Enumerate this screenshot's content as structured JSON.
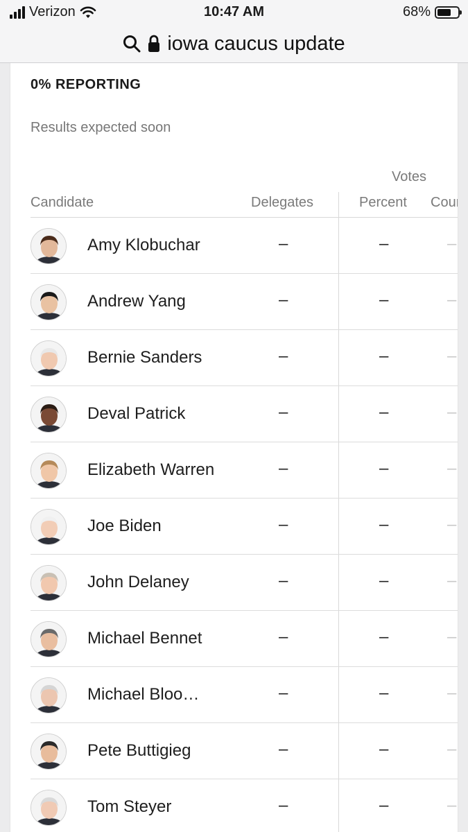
{
  "status_bar": {
    "carrier": "Verizon",
    "time": "10:47 AM",
    "battery": "68%",
    "battery_level": 0.68
  },
  "address_bar": {
    "query": "iowa caucus update"
  },
  "results": {
    "reporting": "0% REPORTING",
    "subtitle": "Results expected soon",
    "votes_header": "Votes",
    "columns": {
      "candidate": "Candidate",
      "delegates": "Delegates",
      "percent": "Percent",
      "count": "Count"
    },
    "candidates": [
      {
        "name": "Amy Klobuchar",
        "delegates": "–",
        "percent": "–",
        "count": "–"
      },
      {
        "name": "Andrew Yang",
        "delegates": "–",
        "percent": "–",
        "count": "–"
      },
      {
        "name": "Bernie Sanders",
        "delegates": "–",
        "percent": "–",
        "count": "–"
      },
      {
        "name": "Deval Patrick",
        "delegates": "–",
        "percent": "–",
        "count": "–"
      },
      {
        "name": "Elizabeth Warren",
        "delegates": "–",
        "percent": "–",
        "count": "–"
      },
      {
        "name": "Joe Biden",
        "delegates": "–",
        "percent": "–",
        "count": "–"
      },
      {
        "name": "John Delaney",
        "delegates": "–",
        "percent": "–",
        "count": "–"
      },
      {
        "name": "Michael Bennet",
        "delegates": "–",
        "percent": "–",
        "count": "–"
      },
      {
        "name": "Michael Bloo…",
        "delegates": "–",
        "percent": "–",
        "count": "–"
      },
      {
        "name": "Pete Buttigieg",
        "delegates": "–",
        "percent": "–",
        "count": "–"
      },
      {
        "name": "Tom Steyer",
        "delegates": "–",
        "percent": "–",
        "count": "–"
      }
    ]
  },
  "colors": {
    "accent_text": "#1a1a1a",
    "muted_text": "#7a7a7a",
    "divider": "#d8d8d8"
  },
  "icons": {
    "search": "search-icon",
    "lock": "lock-icon",
    "wifi": "wifi-icon",
    "signal": "signal-icon",
    "battery": "battery-icon"
  }
}
